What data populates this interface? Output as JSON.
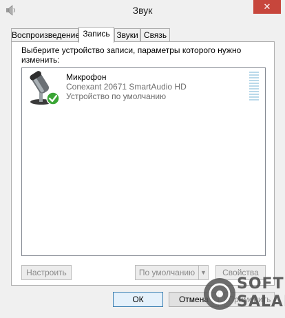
{
  "window": {
    "title": "Звук",
    "close_glyph": "✕"
  },
  "tabs": [
    {
      "label": "Воспроизведение",
      "active": false
    },
    {
      "label": "Запись",
      "active": true
    },
    {
      "label": "Звуки",
      "active": false
    },
    {
      "label": "Связь",
      "active": false
    }
  ],
  "panel": {
    "instruction": "Выберите устройство записи, параметры которого нужно изменить:"
  },
  "devices": [
    {
      "name": "Микрофон",
      "description": "Conexant 20671 SmartAudio HD",
      "status": "Устройство по умолчанию",
      "icon": "microphone-icon",
      "default_badge": "check-icon",
      "level": 0
    }
  ],
  "actions": {
    "configure": "Настроить",
    "set_default": "По умолчанию",
    "set_default_arrow": "▼",
    "properties": "Свойства"
  },
  "dialog_buttons": {
    "ok": "ОК",
    "cancel": "Отмена",
    "apply": "Применить"
  },
  "watermark": {
    "line1": "SOFT",
    "line2": "SALAD"
  },
  "colors": {
    "close_button": "#c7463c",
    "accent_border": "#3c7fb1",
    "level_bar": "#b9d9ea",
    "check_badge": "#3aa535"
  }
}
